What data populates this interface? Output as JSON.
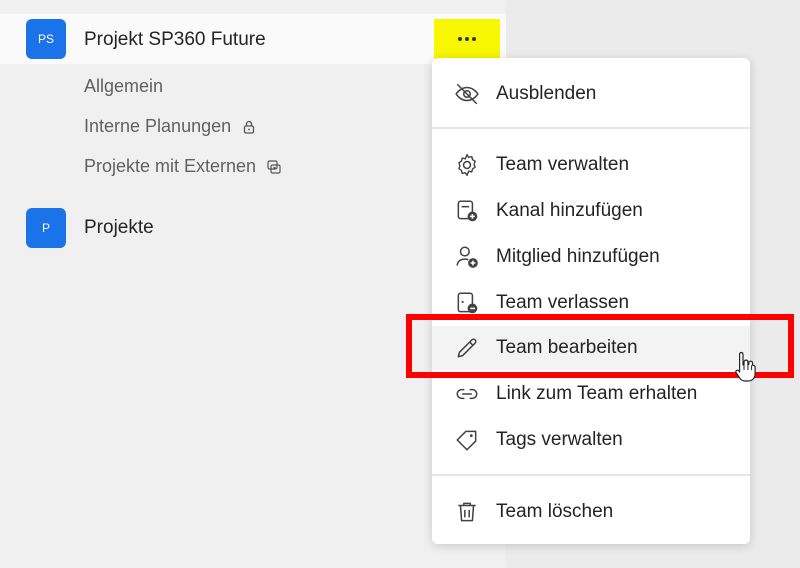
{
  "teams": [
    {
      "initials": "PS",
      "name": "Projekt SP360 Future",
      "avatar_color": "#1a73e8"
    },
    {
      "initials": "P",
      "name": "Projekte",
      "avatar_color": "#1a73e8"
    }
  ],
  "channels": [
    {
      "label": "Allgemein",
      "icon": ""
    },
    {
      "label": "Interne Planungen",
      "icon": "lock-icon"
    },
    {
      "label": "Projekte mit Externen",
      "icon": "shared-channel-icon"
    }
  ],
  "more_button": {
    "icon": "more-options-icon",
    "highlight_color": "#f7f700"
  },
  "context_menu": {
    "hide": "Ausblenden",
    "manage_team": "Team verwalten",
    "add_channel": "Kanal hinzufügen",
    "add_member": "Mitglied hinzufügen",
    "leave_team": "Team verlassen",
    "edit_team": "Team bearbeiten",
    "get_link": "Link zum Team erhalten",
    "manage_tags": "Tags verwalten",
    "delete_team": "Team löschen"
  },
  "highlight_color": "#ff0000"
}
